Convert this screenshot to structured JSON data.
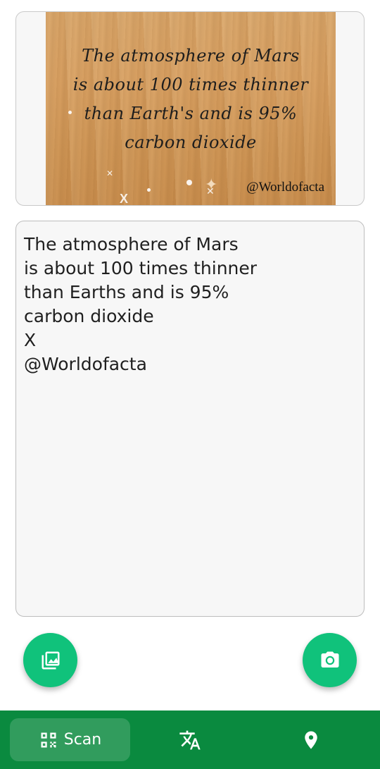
{
  "image_card": {
    "quote_lines": [
      "The atmosphere of Mars",
      "is about 100 times thinner",
      "than Earth's and is 95%",
      "carbon dioxide"
    ],
    "mark": "X",
    "watermark": "@Worldofacta"
  },
  "recognized_text": {
    "lines": [
      "The atmosphere of Mars",
      "is about 100 times thinner",
      "than Earths and is 95%",
      "carbon dioxide",
      "X",
      "@Worldofacta"
    ]
  },
  "fabs": {
    "gallery_icon": "image-icon",
    "camera_icon": "camera-icon",
    "accent_color": "#10c27b"
  },
  "bottom_nav": {
    "background_color": "#0a8a3f",
    "scan_label": "Scan",
    "scan_icon": "qr-code-icon",
    "translate_icon": "translate-icon",
    "location_icon": "location-pin-icon"
  }
}
